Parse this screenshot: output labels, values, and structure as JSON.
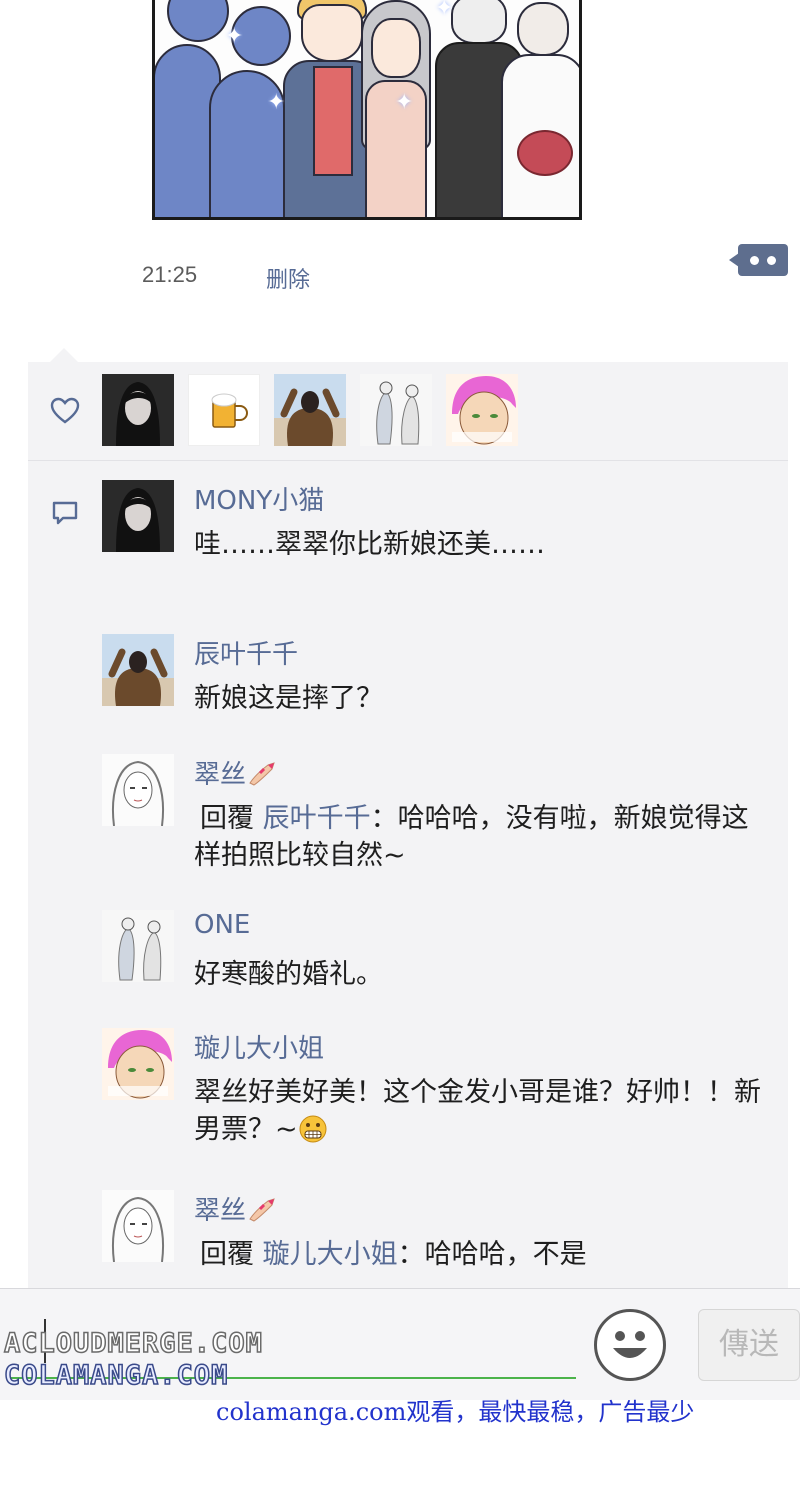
{
  "moment": {
    "time": "21:25",
    "delete_label": "删除"
  },
  "likes": {
    "avatars": [
      "avatar-mony",
      "avatar-beer",
      "avatar-chenye",
      "avatar-one",
      "avatar-xuaner"
    ]
  },
  "comments": [
    {
      "name": "MONY小猫",
      "text": "哇……翠翠你比新娘还美……"
    },
    {
      "name": "辰叶千千",
      "text": "新娘这是摔了？"
    },
    {
      "name": "翠丝",
      "reply_word": "回覆",
      "reply_to": "辰叶千千",
      "text": "：哈哈哈，没有啦，新娘觉得这样拍照比较自然~"
    },
    {
      "name": "ONE",
      "text": "好寒酸的婚礼。"
    },
    {
      "name": "璇儿大小姐",
      "text": "翠丝好美好美！这个金发小哥是谁？好帅！！新男票？~"
    },
    {
      "name": "翠丝",
      "reply_word": "回覆",
      "reply_to": "璇儿大小姐",
      "text": "：哈哈哈，不是"
    }
  ],
  "input": {
    "value": "",
    "send_label": "傳送"
  },
  "watermark": {
    "line1": "ACLOUDMERGE.COM",
    "line2": "COLAMANGA.COM",
    "line3": "colamanga.com观看，最快最稳，广告最少"
  },
  "colors": {
    "link_blue": "#576b95",
    "panel_bg": "#f3f3f5",
    "input_underline": "#4cb34b",
    "watermark_blue": "#2233cc"
  },
  "icons": {
    "like": "heart-outline-icon",
    "comment": "speech-bubble-icon",
    "more": "more-dots-icon",
    "emoji": "smiley-icon",
    "nail_emoji": "nail-polish-icon",
    "grin_emoji": "grimacing-face-icon"
  }
}
